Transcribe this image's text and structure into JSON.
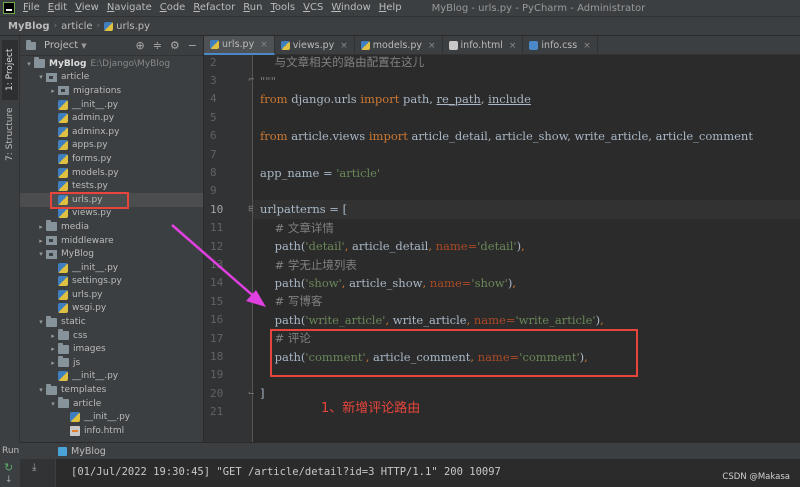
{
  "window": {
    "title": "MyBlog - urls.py - PyCharm - Administrator",
    "menu": [
      "File",
      "Edit",
      "View",
      "Navigate",
      "Code",
      "Refactor",
      "Run",
      "Tools",
      "VCS",
      "Window",
      "Help"
    ]
  },
  "breadcrumb": [
    "MyBlog",
    "article",
    "urls.py"
  ],
  "sidebar_tabs": [
    "1: Project",
    "7: Structure"
  ],
  "project_panel": {
    "title": "Project",
    "tree": [
      {
        "label": "MyBlog",
        "sub": "E:\\Django\\MyBlog",
        "icon": "folder",
        "arrow": "open",
        "root": true
      },
      {
        "label": "article",
        "icon": "pkg",
        "arrow": "open"
      },
      {
        "label": "migrations",
        "icon": "pkg",
        "arrow": "closed"
      },
      {
        "label": "__init__.py",
        "icon": "py"
      },
      {
        "label": "admin.py",
        "icon": "py"
      },
      {
        "label": "adminx.py",
        "icon": "py"
      },
      {
        "label": "apps.py",
        "icon": "py"
      },
      {
        "label": "forms.py",
        "icon": "py"
      },
      {
        "label": "models.py",
        "icon": "py"
      },
      {
        "label": "tests.py",
        "icon": "py"
      },
      {
        "label": "urls.py",
        "icon": "py",
        "selected": true
      },
      {
        "label": "views.py",
        "icon": "py"
      },
      {
        "label": "media",
        "icon": "folder",
        "arrow": "closed"
      },
      {
        "label": "middleware",
        "icon": "pkg",
        "arrow": "closed"
      },
      {
        "label": "MyBlog",
        "icon": "pkg",
        "arrow": "open"
      },
      {
        "label": "__init__.py",
        "icon": "py"
      },
      {
        "label": "settings.py",
        "icon": "py"
      },
      {
        "label": "urls.py",
        "icon": "py"
      },
      {
        "label": "wsgi.py",
        "icon": "py"
      },
      {
        "label": "static",
        "icon": "folder",
        "arrow": "open"
      },
      {
        "label": "css",
        "icon": "folder",
        "arrow": "closed"
      },
      {
        "label": "images",
        "icon": "folder",
        "arrow": "closed"
      },
      {
        "label": "js",
        "icon": "folder",
        "arrow": "closed"
      },
      {
        "label": "__init__.py",
        "icon": "py"
      },
      {
        "label": "templates",
        "icon": "folder",
        "arrow": "open"
      },
      {
        "label": "article",
        "icon": "folder",
        "arrow": "open"
      },
      {
        "label": "__init__.py",
        "icon": "py"
      },
      {
        "label": "info.html",
        "icon": "html"
      }
    ]
  },
  "editor_tabs": [
    {
      "label": "urls.py",
      "active": true
    },
    {
      "label": "views.py"
    },
    {
      "label": "models.py"
    },
    {
      "label": "info.html"
    },
    {
      "label": "info.css"
    }
  ],
  "code_lines": [
    {
      "n": "2",
      "tokens": [
        [
          "cmt",
          "    与文章相关的路由配置在这儿"
        ]
      ]
    },
    {
      "n": "3",
      "tokens": [
        [
          "cmt",
          "\"\"\""
        ]
      ]
    },
    {
      "n": "4",
      "tokens": [
        [
          "kw",
          "from"
        ],
        [
          "tx",
          " django.urls "
        ],
        [
          "kw",
          "import"
        ],
        [
          "tx",
          " path, "
        ],
        [
          "und",
          "re_path"
        ],
        [
          "tx",
          ", "
        ],
        [
          "und",
          "include"
        ]
      ]
    },
    {
      "n": "5",
      "tokens": []
    },
    {
      "n": "6",
      "tokens": [
        [
          "kw",
          "from"
        ],
        [
          "tx",
          " article.views "
        ],
        [
          "kw",
          "import"
        ],
        [
          "tx",
          " article_detail, article_show, write_article, article_comment"
        ]
      ]
    },
    {
      "n": "7",
      "tokens": []
    },
    {
      "n": "8",
      "tokens": [
        [
          "tx",
          "app_name = "
        ],
        [
          "str",
          "'article'"
        ]
      ]
    },
    {
      "n": "9",
      "tokens": []
    },
    {
      "n": "10",
      "tokens": [
        [
          "tx",
          "urlpatterns = ["
        ]
      ],
      "current": true
    },
    {
      "n": "11",
      "tokens": [
        [
          "cmt",
          "    # 文章详情"
        ]
      ]
    },
    {
      "n": "12",
      "tokens": [
        [
          "tx",
          "    path("
        ],
        [
          "str",
          "'detail'"
        ],
        [
          "pun",
          ", "
        ],
        [
          "tx",
          "article_detail"
        ],
        [
          "pun",
          ", "
        ],
        [
          "kwarg",
          "name="
        ],
        [
          "str",
          "'detail'"
        ],
        [
          "tx",
          ")"
        ],
        [
          "pun",
          ","
        ]
      ]
    },
    {
      "n": "13",
      "tokens": [
        [
          "cmt",
          "    # 学无止境列表"
        ]
      ]
    },
    {
      "n": "14",
      "tokens": [
        [
          "tx",
          "    path("
        ],
        [
          "str",
          "'show'"
        ],
        [
          "pun",
          ", "
        ],
        [
          "tx",
          "article_show"
        ],
        [
          "pun",
          ", "
        ],
        [
          "kwarg",
          "name="
        ],
        [
          "str",
          "'show'"
        ],
        [
          "tx",
          ")"
        ],
        [
          "pun",
          ","
        ]
      ]
    },
    {
      "n": "15",
      "tokens": [
        [
          "cmt",
          "    # 写博客"
        ]
      ]
    },
    {
      "n": "16",
      "tokens": [
        [
          "tx",
          "    path("
        ],
        [
          "str",
          "'write_article'"
        ],
        [
          "pun",
          ", "
        ],
        [
          "tx",
          "write_article"
        ],
        [
          "pun",
          ", "
        ],
        [
          "kwarg",
          "name="
        ],
        [
          "str",
          "'write_article'"
        ],
        [
          "tx",
          ")"
        ],
        [
          "pun",
          ","
        ]
      ]
    },
    {
      "n": "17",
      "tokens": [
        [
          "cmt",
          "    # 评论"
        ]
      ]
    },
    {
      "n": "18",
      "tokens": [
        [
          "tx",
          "    path("
        ],
        [
          "str",
          "'comment'"
        ],
        [
          "pun",
          ", "
        ],
        [
          "tx",
          "article_comment"
        ],
        [
          "pun",
          ", "
        ],
        [
          "kwarg",
          "name="
        ],
        [
          "str",
          "'comment'"
        ],
        [
          "tx",
          ")"
        ],
        [
          "pun",
          ","
        ]
      ]
    },
    {
      "n": "19",
      "tokens": []
    },
    {
      "n": "20",
      "tokens": [
        [
          "tx",
          "]"
        ]
      ]
    },
    {
      "n": "21",
      "tokens": []
    }
  ],
  "annotation": {
    "text": "1、新增评论路由",
    "color": "#e8453c"
  },
  "run_panel": {
    "label": "Run:",
    "tab": "MyBlog",
    "output": "[01/Jul/2022 19:30:45] \"GET /article/detail?id=3 HTTP/1.1\" 200 10097"
  },
  "watermark": "CSDN @Makasa",
  "colors": {
    "keyword": "#cc7832",
    "string": "#6a8759",
    "comment": "#808080",
    "kwarg": "#aa4926",
    "highlight": "#e8453c",
    "arrow": "#e040e0"
  }
}
